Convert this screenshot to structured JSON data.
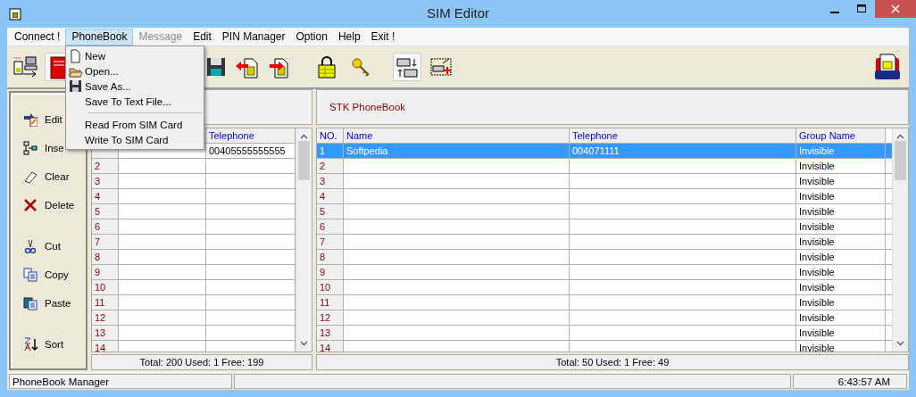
{
  "window": {
    "title": "SIM Editor"
  },
  "menu": [
    {
      "label": "Connect !",
      "selected": false,
      "disabled": false
    },
    {
      "label": "PhoneBook",
      "selected": true,
      "disabled": false
    },
    {
      "label": "Message",
      "selected": false,
      "disabled": true
    },
    {
      "label": "Edit",
      "selected": false,
      "disabled": false
    },
    {
      "label": "PIN Manager",
      "selected": false,
      "disabled": false
    },
    {
      "label": "Option",
      "selected": false,
      "disabled": false
    },
    {
      "label": "Help",
      "selected": false,
      "disabled": false
    },
    {
      "label": "Exit !",
      "selected": false,
      "disabled": false
    }
  ],
  "dropdown": [
    {
      "kind": "item",
      "label": "New"
    },
    {
      "kind": "item",
      "label": "Open..."
    },
    {
      "kind": "item",
      "label": "Save As..."
    },
    {
      "kind": "item",
      "label": "Save To Text File..."
    },
    {
      "kind": "separator"
    },
    {
      "kind": "item",
      "label": "Read From SIM Card"
    },
    {
      "kind": "item",
      "label": "Write To SIM Card"
    }
  ],
  "toolbar": [
    {
      "pressed": false
    },
    {
      "pressed": true
    },
    {
      "pressed": false
    },
    {
      "pressed": false
    },
    {
      "pressed": false
    },
    {
      "pressed": false
    },
    {
      "pressed": false
    },
    {
      "pressed": true
    },
    {
      "pressed": false
    }
  ],
  "side_buttons": [
    "Edit",
    "Inse",
    "Clear",
    "Delete",
    "Cut",
    "Copy",
    "Paste",
    "Sort"
  ],
  "sim_table": {
    "telephone_header": "Telephone",
    "rows": [
      {
        "telephone": "00405555555555"
      },
      {
        "number": "2"
      },
      {
        "number": "3"
      },
      {
        "number": "4"
      },
      {
        "number": "5"
      },
      {
        "number": "6"
      },
      {
        "number": "7"
      },
      {
        "number": "8"
      },
      {
        "number": "9"
      },
      {
        "number": "10"
      },
      {
        "number": "11"
      },
      {
        "number": "12"
      },
      {
        "number": "13"
      },
      {
        "number": "14"
      }
    ],
    "footer": "Total: 200  Used: 1  Free: 199"
  },
  "stk_table": {
    "title": "STK PhoneBook",
    "columns": [
      "NO.",
      "Name",
      "Telephone",
      "Group Name"
    ],
    "rows": [
      {
        "number": "1",
        "name": "Softpedia",
        "telephone": "004071111",
        "group": "Invisible",
        "selected": true
      },
      {
        "number": "2",
        "group": "Invisible",
        "selected": false
      },
      {
        "number": "3",
        "group": "Invisible",
        "selected": false
      },
      {
        "number": "4",
        "group": "Invisible",
        "selected": false
      },
      {
        "number": "5",
        "group": "Invisible",
        "selected": false
      },
      {
        "number": "6",
        "group": "Invisible",
        "selected": false
      },
      {
        "number": "7",
        "group": "Invisible",
        "selected": false
      },
      {
        "number": "8",
        "group": "Invisible",
        "selected": false
      },
      {
        "number": "9",
        "group": "Invisible",
        "selected": false
      },
      {
        "number": "10",
        "group": "Invisible",
        "selected": false
      },
      {
        "number": "11",
        "group": "Invisible",
        "selected": false
      },
      {
        "number": "12",
        "group": "Invisible",
        "selected": false
      },
      {
        "number": "13",
        "group": "Invisible",
        "selected": false
      },
      {
        "number": "14",
        "group": "Invisible",
        "selected": false
      }
    ],
    "footer": "Total: 50  Used: 1  Free: 49"
  },
  "status_bar": {
    "left": "PhoneBook Manager",
    "time": "6:43:57 AM"
  }
}
